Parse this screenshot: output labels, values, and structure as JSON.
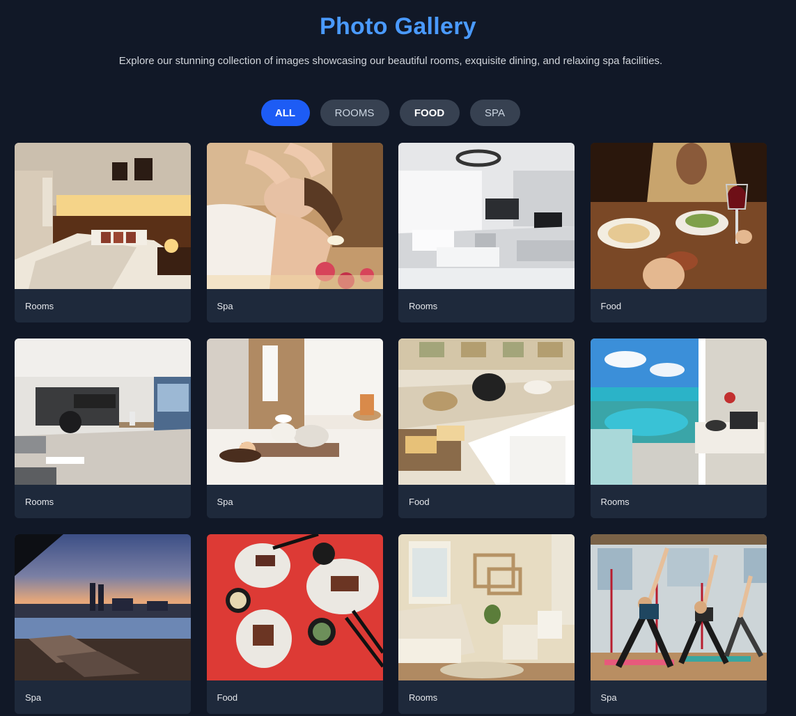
{
  "header": {
    "title": "Photo Gallery",
    "subtitle": "Explore our stunning collection of images showcasing our beautiful rooms, exquisite dining, and relaxing spa facilities."
  },
  "filters": [
    {
      "label": "ALL",
      "active": true
    },
    {
      "label": "ROOMS",
      "active": false
    },
    {
      "label": "FOOD",
      "active": false
    },
    {
      "label": "SPA",
      "active": false
    }
  ],
  "gallery": [
    {
      "category": "Rooms",
      "scene": "hotel-bedroom"
    },
    {
      "category": "Spa",
      "scene": "spa-massage"
    },
    {
      "category": "Rooms",
      "scene": "white-living-room"
    },
    {
      "category": "Food",
      "scene": "dining-wine"
    },
    {
      "category": "Rooms",
      "scene": "modern-apartment"
    },
    {
      "category": "Spa",
      "scene": "spa-towels-candles"
    },
    {
      "category": "Food",
      "scene": "buffet-breakfast"
    },
    {
      "category": "Rooms",
      "scene": "balcony-ocean-view"
    },
    {
      "category": "Spa",
      "scene": "rooftop-infinity-pool"
    },
    {
      "category": "Food",
      "scene": "sushi-plates"
    },
    {
      "category": "Rooms",
      "scene": "vintage-bedroom"
    },
    {
      "category": "Spa",
      "scene": "yoga-class"
    }
  ],
  "colors": {
    "background": "#111827",
    "accent": "#4a9aff",
    "active_filter": "#1d5cf5",
    "filter_bg": "#374151",
    "card_bg": "#1e293b"
  }
}
